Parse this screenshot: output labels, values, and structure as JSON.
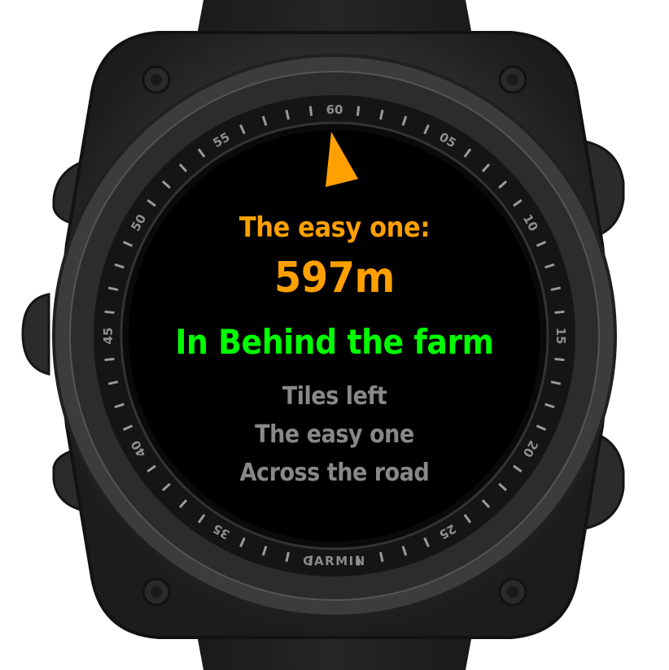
{
  "watch": {
    "brand": "GARMIN",
    "bezel_numbers": [
      "60",
      "05",
      "10",
      "15",
      "20",
      "25",
      "35",
      "40",
      "45",
      "50",
      "55"
    ]
  },
  "screen": {
    "pointer_icon": "direction-arrow-icon",
    "target_label": "The easy one:",
    "distance": "597m",
    "current_location": "In Behind the farm",
    "list": [
      "Tiles left",
      "The easy one",
      "Across the road"
    ]
  },
  "colors": {
    "accent": "#ffa000",
    "location": "#00ff00",
    "muted": "#888888",
    "screen_bg": "#000000"
  }
}
